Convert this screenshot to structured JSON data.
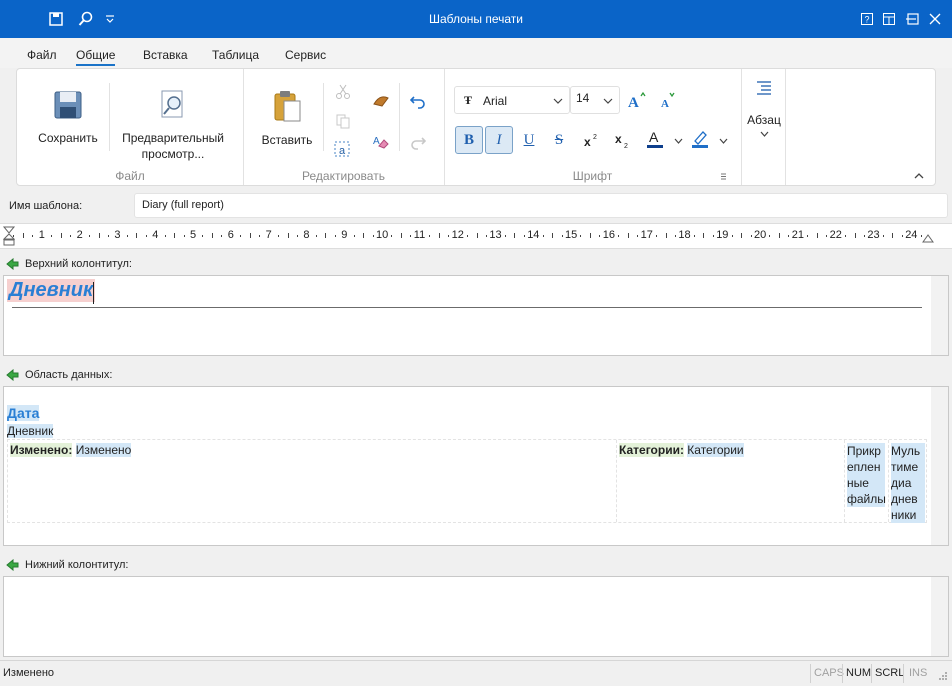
{
  "window": {
    "title": "Шаблоны печати"
  },
  "tabs": [
    "Файл",
    "Общие",
    "Вставка",
    "Таблица",
    "Сервис"
  ],
  "ribbon": {
    "file_group": {
      "label": "Файл",
      "save": "Сохранить",
      "preview_line1": "Предварительный",
      "preview_line2": "просмотр..."
    },
    "edit_group": {
      "label": "Редактировать",
      "paste": "Вставить"
    },
    "font_group": {
      "label": "Шрифт",
      "font_name": "Arial",
      "font_size": "14",
      "bold": "B",
      "italic": "I",
      "underline": "U",
      "strike": "S"
    },
    "paragraph": {
      "label": "Абзац"
    }
  },
  "template_name": {
    "label": "Имя шаблона:",
    "value": "Diary (full report)"
  },
  "ruler": {
    "numbers": [
      "1",
      "2",
      "3",
      "4",
      "5",
      "6",
      "7",
      "8",
      "9",
      "10",
      "11",
      "12",
      "13",
      "14",
      "15",
      "16",
      "17",
      "18",
      "19",
      "20",
      "21",
      "22",
      "23",
      "24"
    ]
  },
  "header_section": {
    "title": "Верхний колонтитул:",
    "heading_text": "Дневник"
  },
  "data_section": {
    "title": "Область данных:",
    "date_label": "Дата",
    "diary_label": "Дневник",
    "changed_label": "Изменено:",
    "changed_value": "Изменено",
    "categories_label": "Категории:",
    "categories_value": "Категории",
    "attached_lines": [
      "Прикр",
      "еплен",
      "ные",
      "файлы"
    ],
    "multimedia_lines": [
      "Муль",
      "тиме",
      "диа",
      "днев",
      "ники"
    ]
  },
  "footer_section": {
    "title": "Нижний колонтитул:"
  },
  "status": {
    "text": "Изменено",
    "indicators": [
      {
        "label": "CAPS",
        "active": false
      },
      {
        "label": "NUM",
        "active": true
      },
      {
        "label": "SCRL",
        "active": true
      },
      {
        "label": "INS",
        "active": false
      }
    ]
  },
  "colors": {
    "titlebar": "#0a64c8",
    "accent": "#1a73c8",
    "heading_blue": "#2a7fd4"
  }
}
